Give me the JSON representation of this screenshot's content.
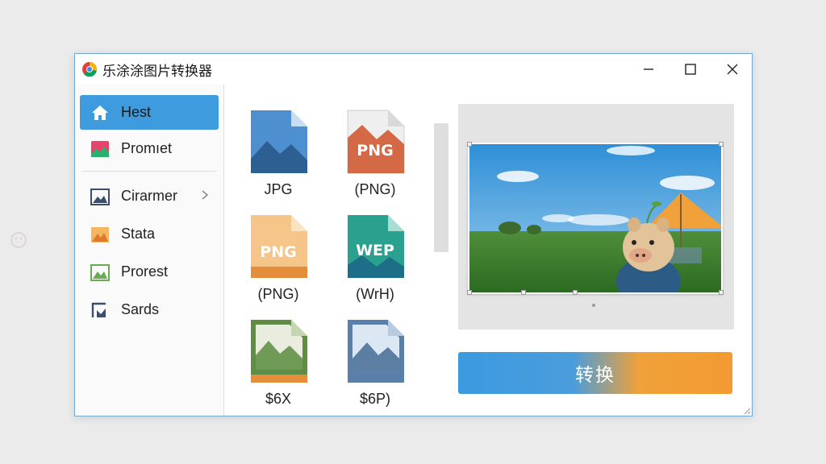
{
  "window": {
    "title": "乐涂涂图片转换器"
  },
  "sidebar": {
    "items": [
      {
        "label": "Hest",
        "icon": "home-icon",
        "active": true
      },
      {
        "label": "Promıet",
        "icon": "image-chart-icon",
        "active": false
      },
      {
        "label": "Cirarmer",
        "icon": "image-icon",
        "active": false,
        "has_submenu": true
      },
      {
        "label": "Stata",
        "icon": "image-orange-icon",
        "active": false
      },
      {
        "label": "Prorest",
        "icon": "image-green-icon",
        "active": false
      },
      {
        "label": "Sards",
        "icon": "image-crop-icon",
        "active": false
      }
    ]
  },
  "formats": [
    {
      "label": "JPG",
      "icon_text": "",
      "icon": "jpg-file-icon",
      "color": "#4e8fd0"
    },
    {
      "label": "(PNG)",
      "icon_text": "PNG",
      "icon": "png-file-icon",
      "color": "#d46a45"
    },
    {
      "label": "(PNG)",
      "icon_text": "PNG",
      "icon": "png-file-orange-icon",
      "color": "#f3b46a"
    },
    {
      "label": "(WrH)",
      "icon_text": "WEP",
      "icon": "webp-file-icon",
      "color": "#2aa08f"
    },
    {
      "label": "$6X",
      "icon_text": "",
      "icon": "image-file-green-icon",
      "color": "#5f8d45"
    },
    {
      "label": "$6P)",
      "icon_text": "",
      "icon": "image-file-blue-icon",
      "color": "#5a7fa8"
    }
  ],
  "actions": {
    "convert_label": "转换"
  },
  "colors": {
    "accent": "#3e9bde",
    "button_gradient_start": "#3c9ae0",
    "button_gradient_end": "#f39a32",
    "window_border": "#6fa9d6"
  }
}
